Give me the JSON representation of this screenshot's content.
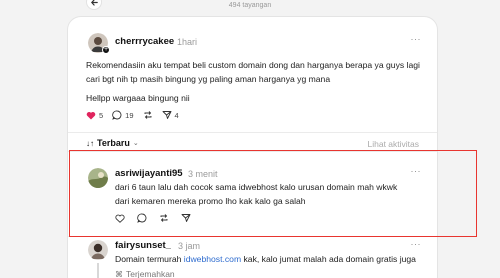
{
  "header": {
    "views": "494 tayangan"
  },
  "post": {
    "username": "cherrrycakee",
    "time": "1hari",
    "more": "···",
    "line1": "Rekomendasiin aku tempat beli custom domain dong dan harganya berapa ya guys lagi",
    "line2": "cari bgt nih tp masih bingung yg paling aman harganya yg mana",
    "line3": "Hellpp wargaaa bingung nii",
    "likes": "5",
    "comments": "19",
    "shares": "4"
  },
  "sort": {
    "label": "Terbaru",
    "activity": "Lihat aktivitas"
  },
  "reply1": {
    "username": "asriwijayanti95",
    "time": "3 menit",
    "more": "···",
    "line1": "dari 6 taun lalu dah cocok sama idwebhost kalo urusan domain mah wkwk",
    "line2": "dari kemaren mereka promo lho kak kalo ga salah"
  },
  "reply2": {
    "username": "fairysunset_",
    "time": "3 jam",
    "more": "···",
    "text_before": "Domain termurah ",
    "link": "idwebhost.com",
    "text_after": " kak, kalo jumat malah ada domain gratis juga",
    "translate": "Terjemahkan"
  },
  "colors": {
    "heart": "#e0245e",
    "highlight_border": "#e8352f",
    "link": "#2e6ccf"
  }
}
